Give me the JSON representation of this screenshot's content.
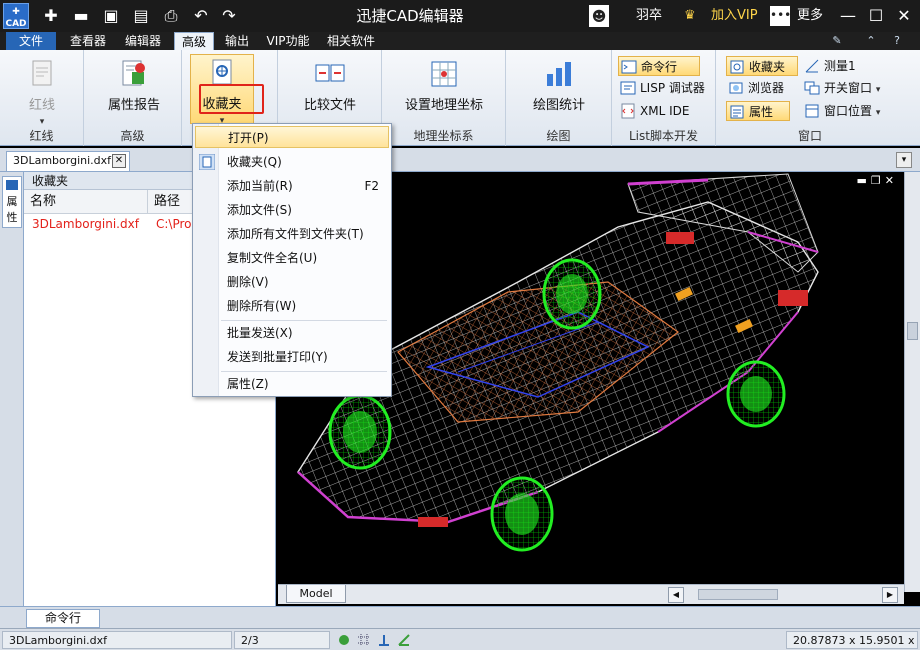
{
  "app": {
    "logo_text": "CAD",
    "title": "迅捷CAD编辑器"
  },
  "titlebar": {
    "user": "羽卒",
    "vip": "加入VIP",
    "more": "更多"
  },
  "menu_tabs": [
    "文件",
    "查看器",
    "编辑器",
    "高级",
    "输出",
    "VIP功能",
    "相关软件"
  ],
  "ribbon": {
    "redline": {
      "label": "红线",
      "group": "红线"
    },
    "advanced": {
      "label": "属性报告",
      "group": "高级"
    },
    "favorites": {
      "label": "收藏夹"
    },
    "compare": {
      "label": "比较文件"
    },
    "geo": {
      "label": "设置地理坐标",
      "group": "地理坐标系"
    },
    "drawing": {
      "label": "绘图统计",
      "group": "绘图"
    },
    "lisp": {
      "items": [
        "命令行",
        "LISP 调试器",
        "XML IDE"
      ],
      "group": "List脚本开发"
    },
    "window": {
      "items": [
        "收藏夹",
        "浏览器",
        "属性",
        "测量1",
        "开关窗口",
        "窗口位置"
      ],
      "group": "窗口"
    }
  },
  "document": {
    "tab": "3DLamborgini.dxf"
  },
  "side_tab": "属性",
  "panel": {
    "title": "收藏夹",
    "columns": [
      "名称",
      "路径"
    ],
    "rows": [
      {
        "name": "3DLamborgini.dxf",
        "path": "C:\\Prog"
      }
    ]
  },
  "dropdown": {
    "items": [
      {
        "label": "打开(P)",
        "shortcut": ""
      },
      {
        "label": "收藏夹(Q)",
        "shortcut": ""
      },
      {
        "label": "添加当前(R)",
        "shortcut": "F2"
      },
      {
        "label": "添加文件(S)",
        "shortcut": ""
      },
      {
        "label": "添加所有文件到文件夹(T)",
        "shortcut": ""
      },
      {
        "label": "复制文件全名(U)",
        "shortcut": ""
      },
      {
        "label": "删除(V)",
        "shortcut": ""
      },
      {
        "label": "删除所有(W)",
        "shortcut": ""
      },
      {
        "label": "批量发送(X)",
        "shortcut": ""
      },
      {
        "label": "发送到批量打印(Y)",
        "shortcut": ""
      },
      {
        "label": "属性(Z)",
        "shortcut": ""
      }
    ]
  },
  "canvas": {
    "layout_tab": "Model"
  },
  "command": {
    "tab": "命令行"
  },
  "status": {
    "file": "3DLamborgini.dxf",
    "page": "2/3",
    "coords": "20.87873 x 15.9501 x 0"
  },
  "colors": {
    "accent": "#2766b6",
    "highlight": "#e0241a",
    "wire_green": "#22ee22"
  }
}
